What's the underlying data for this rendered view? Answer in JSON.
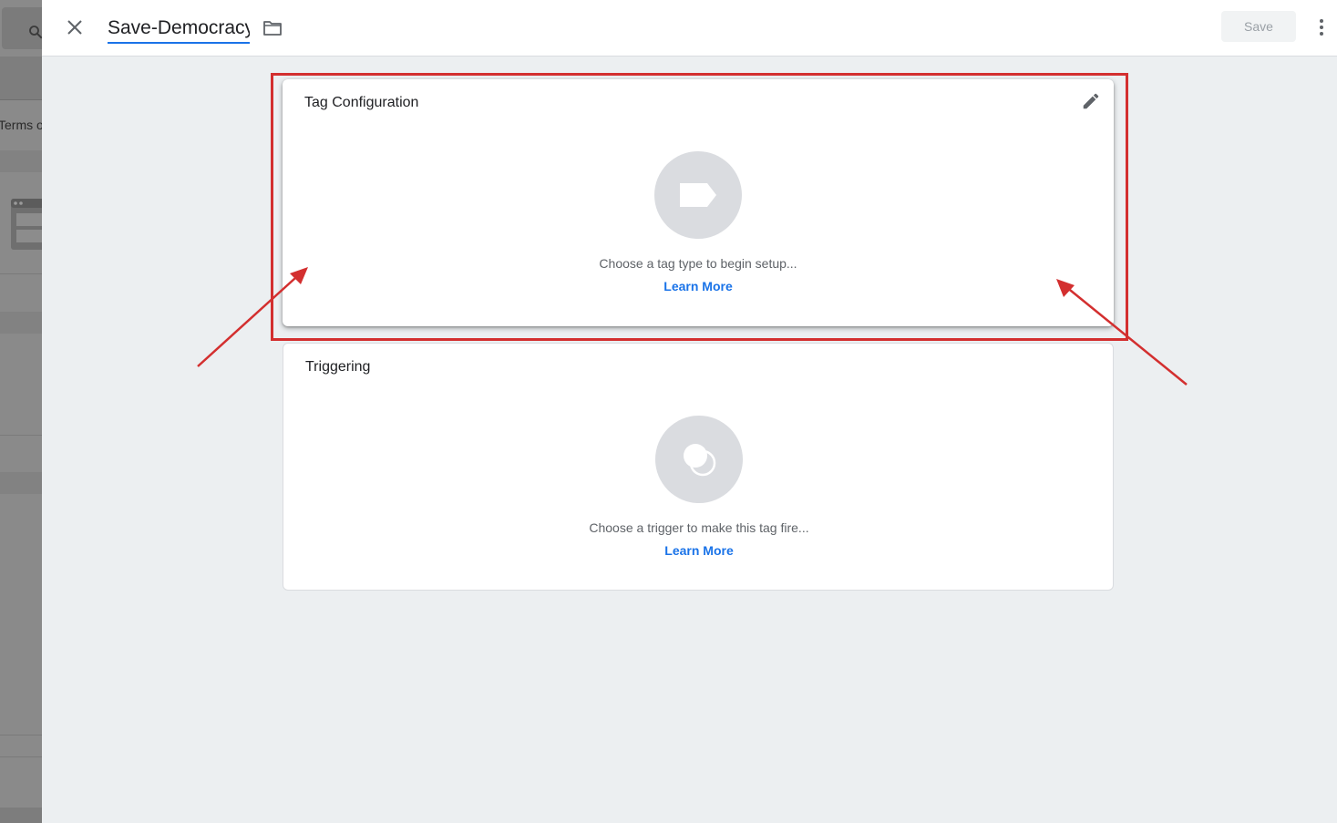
{
  "background": {
    "terms_text": "Terms o"
  },
  "header": {
    "tag_name": "Save-Democracy",
    "save_label": "Save"
  },
  "tag_configuration": {
    "title": "Tag Configuration",
    "hint": "Choose a tag type to begin setup...",
    "learn_more": "Learn More"
  },
  "triggering": {
    "title": "Triggering",
    "hint": "Choose a trigger to make this tag fire...",
    "learn_more": "Learn More"
  },
  "colors": {
    "accent": "#1a73e8",
    "annotation": "#d32f2f"
  }
}
